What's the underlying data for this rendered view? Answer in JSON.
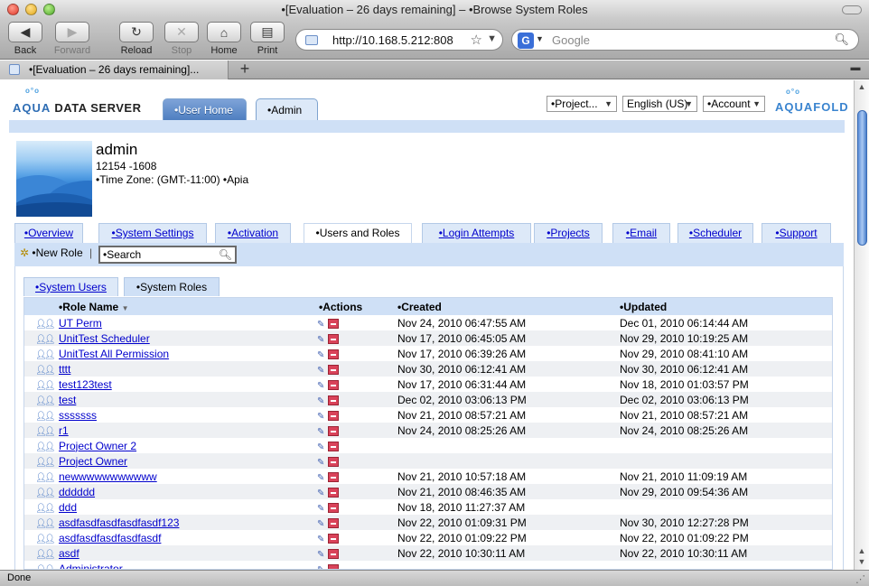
{
  "window": {
    "title": "•[Evaluation – 26 days remaining] – •Browse System Roles"
  },
  "toolbar": {
    "back": "Back",
    "forward": "Forward",
    "reload": "Reload",
    "stop": "Stop",
    "home": "Home",
    "print": "Print",
    "url": "http://10.168.5.212:808",
    "search_placeholder": "Google"
  },
  "browser_tab": {
    "title": "•[Evaluation – 26 days remaining]..."
  },
  "status": {
    "text": "Done"
  },
  "header": {
    "logo_left_accent": "AQUA",
    "logo_left_rest": "DATA SERVER",
    "nav_user_home": "•User Home",
    "nav_admin": "•Admin",
    "project_select": "•Project...",
    "language_select": "English (US)",
    "account_select": "•Account",
    "logo_right": "AQUAFOLD"
  },
  "profile": {
    "name": "admin",
    "id": "12154 -1608",
    "timezone": "•Time Zone: (GMT:-11:00) •Apia"
  },
  "admin_tabs": [
    {
      "label": "•Overview"
    },
    {
      "label": "•System Settings"
    },
    {
      "label": "•Activation"
    },
    {
      "label": "•Users and Roles"
    },
    {
      "label": "•Login Attempts"
    },
    {
      "label": "•Projects"
    },
    {
      "label": "•Email"
    },
    {
      "label": "•Scheduler"
    },
    {
      "label": "•Support"
    }
  ],
  "actions": {
    "new_role": "•New Role",
    "separator": "|",
    "search_value": "•Search"
  },
  "role_tabs": {
    "system_users": "•System Users",
    "system_roles": "•System Roles"
  },
  "table": {
    "headers": {
      "role_name": "•Role Name",
      "actions": "•Actions",
      "created": "•Created",
      "updated": "•Updated"
    },
    "rows": [
      {
        "name": "UT Perm",
        "created": "Nov 24, 2010 06:47:55 AM",
        "updated": "Dec 01, 2010 06:14:44 AM"
      },
      {
        "name": "UnitTest Scheduler",
        "created": "Nov 17, 2010 06:45:05 AM",
        "updated": "Nov 29, 2010 10:19:25 AM"
      },
      {
        "name": "UnitTest All Permission",
        "created": "Nov 17, 2010 06:39:26 AM",
        "updated": "Nov 29, 2010 08:41:10 AM"
      },
      {
        "name": "tttt",
        "created": "Nov 30, 2010 06:12:41 AM",
        "updated": "Nov 30, 2010 06:12:41 AM"
      },
      {
        "name": "test123test",
        "created": "Nov 17, 2010 06:31:44 AM",
        "updated": "Nov 18, 2010 01:03:57 PM"
      },
      {
        "name": "test",
        "created": "Dec 02, 2010 03:06:13 PM",
        "updated": "Dec 02, 2010 03:06:13 PM"
      },
      {
        "name": "sssssss",
        "created": "Nov 21, 2010 08:57:21 AM",
        "updated": "Nov 21, 2010 08:57:21 AM"
      },
      {
        "name": "r1",
        "created": "Nov 24, 2010 08:25:26 AM",
        "updated": "Nov 24, 2010 08:25:26 AM"
      },
      {
        "name": "Project Owner 2",
        "created": "",
        "updated": ""
      },
      {
        "name": "Project Owner",
        "created": "",
        "updated": ""
      },
      {
        "name": "newwwwwwwwwww",
        "created": "Nov 21, 2010 10:57:18 AM",
        "updated": "Nov 21, 2010 11:09:19 AM"
      },
      {
        "name": "dddddd",
        "created": "Nov 21, 2010 08:46:35 AM",
        "updated": "Nov 29, 2010 09:54:36 AM"
      },
      {
        "name": "ddd",
        "created": "Nov 18, 2010 11:27:37 AM",
        "updated": ""
      },
      {
        "name": "asdfasdfasdfasdfasdf123",
        "created": "Nov 22, 2010 01:09:31 PM",
        "updated": "Nov 30, 2010 12:27:28 PM"
      },
      {
        "name": "asdfasdfasdfasdfasdf",
        "created": "Nov 22, 2010 01:09:22 PM",
        "updated": "Nov 22, 2010 01:09:22 PM"
      },
      {
        "name": "asdf",
        "created": "Nov 22, 2010 10:30:11 AM",
        "updated": "Nov 22, 2010 10:30:11 AM"
      },
      {
        "name": "Administrator",
        "created": "",
        "updated": ""
      }
    ]
  }
}
